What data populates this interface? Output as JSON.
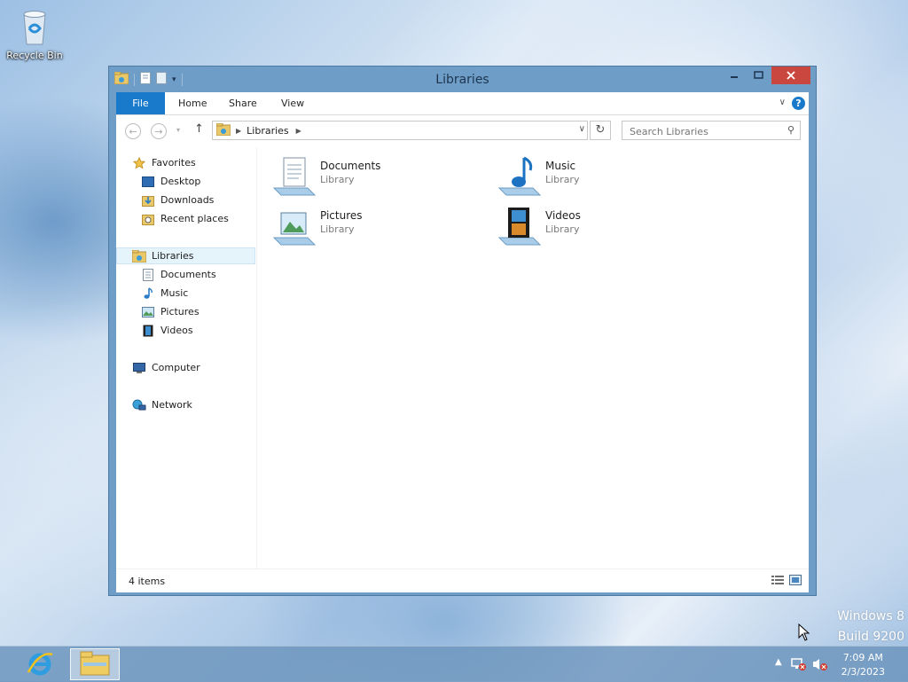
{
  "desktop": {
    "recycle_bin_label": "Recycle Bin",
    "watermark": {
      "line1": "Windows 8",
      "line2": "Build 9200"
    }
  },
  "window": {
    "title": "Libraries",
    "ribbon_tabs": [
      "File",
      "Home",
      "Share",
      "View"
    ],
    "address": {
      "crumb": "Libraries"
    },
    "search": {
      "placeholder": "Search Libraries"
    },
    "nav": {
      "favorites": "Favorites",
      "desktop": "Desktop",
      "downloads": "Downloads",
      "recent": "Recent places",
      "libraries": "Libraries",
      "documents": "Documents",
      "music": "Music",
      "pictures": "Pictures",
      "videos": "Videos",
      "computer": "Computer",
      "network": "Network"
    },
    "items": [
      {
        "name": "Documents",
        "type": "Library"
      },
      {
        "name": "Music",
        "type": "Library"
      },
      {
        "name": "Pictures",
        "type": "Library"
      },
      {
        "name": "Videos",
        "type": "Library"
      }
    ],
    "status": {
      "count": "4 items"
    }
  },
  "taskbar": {
    "clock": {
      "time": "7:09 AM",
      "date": "2/3/2023"
    }
  },
  "colors": {
    "accent": "#1979ca",
    "close": "#c9473f",
    "frame": "#6e9ec7"
  }
}
